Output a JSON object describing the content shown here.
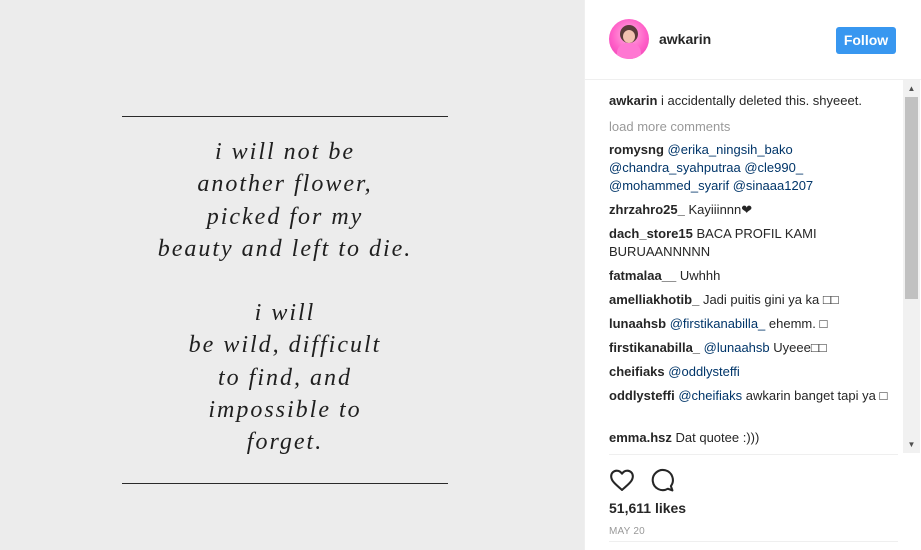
{
  "post": {
    "quote_lines_1": [
      "i will not be",
      "another flower,",
      "picked for my",
      "beauty and left to die."
    ],
    "quote_lines_2": [
      "i will",
      "be wild, difficult",
      "to find, and",
      "impossible to",
      "forget."
    ]
  },
  "header": {
    "username": "awkarin",
    "follow_label": "Follow"
  },
  "caption": {
    "user": "awkarin",
    "text": "i accidentally deleted this. shyeeet."
  },
  "load_more_label": "load more comments",
  "comments": [
    {
      "user": "romysng",
      "mention": "@erika_ningsih_bako @chandra_syahputraa @cle990_ @mohammed_syarif @sinaaa1207",
      "text": ""
    },
    {
      "user": "zhrzahro25_",
      "mention": "",
      "text": "Kayiiinnn❤"
    },
    {
      "user": "dach_store15",
      "mention": "",
      "text": "BACA PROFIL KAMI BURUAANNNNN"
    },
    {
      "user": "fatmalaa__",
      "mention": "",
      "text": "Uwhhh"
    },
    {
      "user": "amelliakhotib_",
      "mention": "",
      "text": "Jadi puitis gini ya ka □□"
    },
    {
      "user": "lunaahsb",
      "mention": "@firstikanabilla_",
      "text": "ehemm. □"
    },
    {
      "user": "firstikanabilla_",
      "mention": "@lunaahsb",
      "text": "Uyeee□□"
    },
    {
      "user": "cheifiaks",
      "mention": "@oddlysteffi",
      "text": ""
    },
    {
      "user": "oddlysteffi",
      "mention": "@cheifiaks",
      "text": "awkarin banget tapi ya □"
    },
    {
      "user": "emma.hsz",
      "mention": "",
      "text": "Dat quotee :)))"
    }
  ],
  "likes_text": "51,611 likes",
  "date_text": "MAY 20",
  "icons": {
    "like": "heart-icon",
    "comment": "speech-bubble-icon",
    "scroll_up": "arrow-up-icon",
    "scroll_down": "arrow-down-icon"
  },
  "colors": {
    "follow_button": "#3897f0",
    "mention": "#003569",
    "muted": "#999999",
    "media_background": "#ececec"
  }
}
